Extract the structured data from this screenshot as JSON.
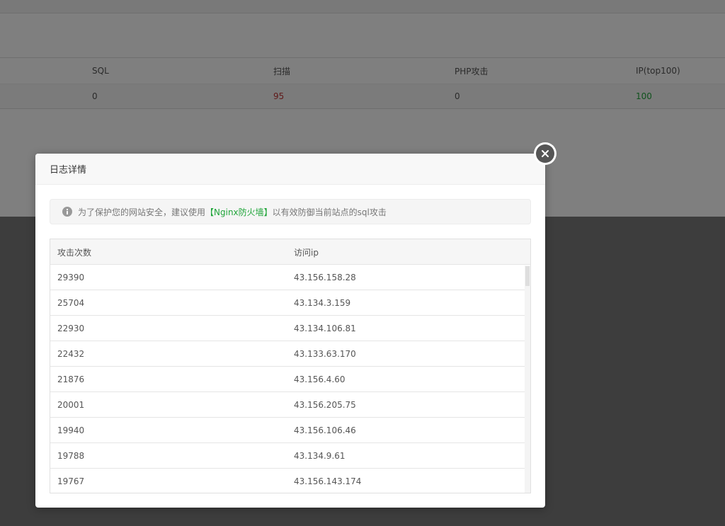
{
  "background": {
    "columns": [
      "SQL",
      "扫描",
      "PHP攻击",
      "IP(top100)"
    ],
    "values": [
      "0",
      "95",
      "0",
      "100"
    ]
  },
  "modal": {
    "title": "日志详情",
    "tip": {
      "prefix": "为了保护您的网站安全，建议使用",
      "link": "【Nginx防火墙】",
      "suffix": "以有效防御当前站点的sql攻击"
    },
    "table": {
      "headers": [
        "攻击次数",
        "访问ip"
      ],
      "rows": [
        [
          "29390",
          "43.156.158.28"
        ],
        [
          "25704",
          "43.134.3.159"
        ],
        [
          "22930",
          "43.134.106.81"
        ],
        [
          "22432",
          "43.133.63.170"
        ],
        [
          "21876",
          "43.156.4.60"
        ],
        [
          "20001",
          "43.156.205.75"
        ],
        [
          "19940",
          "43.156.106.46"
        ],
        [
          "19788",
          "43.134.9.61"
        ],
        [
          "19767",
          "43.156.143.174"
        ]
      ]
    }
  },
  "icons": {
    "close": "close-icon",
    "info": "info-icon"
  },
  "colors": {
    "accent_green": "#20a53a",
    "warning_red": "#c03535"
  }
}
